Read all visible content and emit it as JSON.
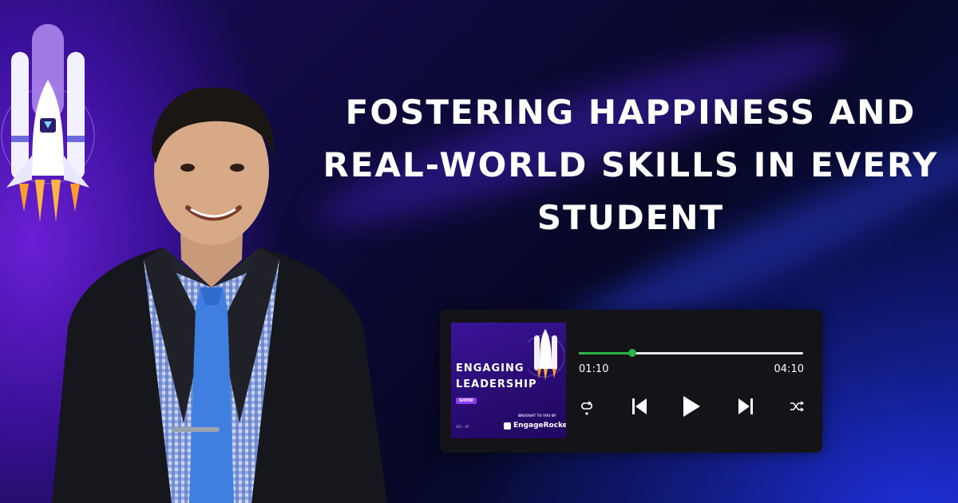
{
  "headline": {
    "line1": "FOSTERING HAPPINESS AND",
    "line2": "REAL-WORLD SKILLS IN EVERY",
    "line3": "STUDENT"
  },
  "player": {
    "cover": {
      "title_line1": "ENGAGING",
      "title_line2": "LEADERSHIP",
      "badge": "SHOW",
      "brought_by": "BROUGHT TO YOU BY",
      "brand": "EngageRocket",
      "tiny": "S01 · EP"
    },
    "progress": 0.24,
    "elapsed": "01:10",
    "duration": "04:10"
  },
  "colors": {
    "accent_green": "#2db24a",
    "player_bg": "#141418",
    "cover_purple": "#2a0c73"
  },
  "icons": [
    "repeat-icon",
    "skip-previous-icon",
    "play-icon",
    "skip-next-icon",
    "shuffle-icon"
  ]
}
